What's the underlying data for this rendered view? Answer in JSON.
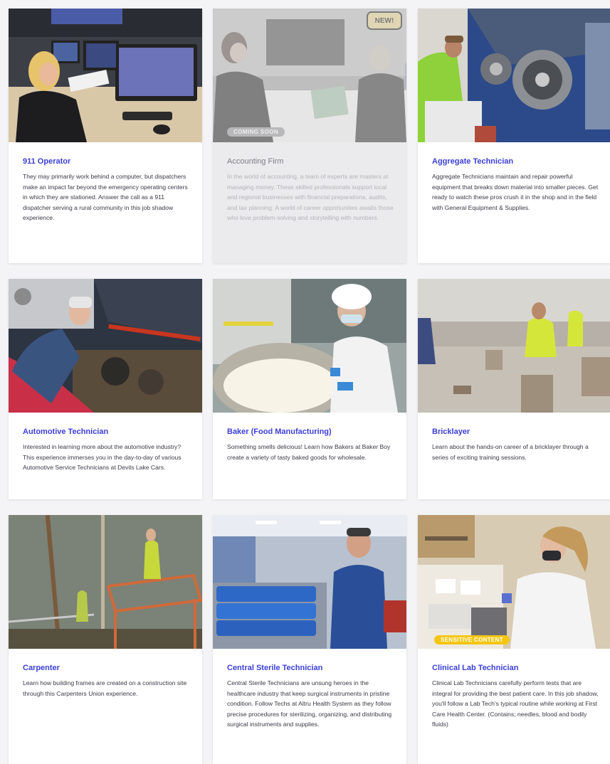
{
  "colors": {
    "title": "#3b3fd6",
    "coming_soon_badge": "#8f8f95",
    "sensitive_badge": "#f4c60f",
    "new_badge": "#f6c628"
  },
  "cards": [
    {
      "title": "911 Operator",
      "description": "They may primarily work behind a computer, but dispatchers make an impact far beyond the emergency operating centers in which they are stationed. Answer the call as a 911 dispatcher serving a rural community in this job shadow experience.",
      "image": "dispatcher-at-monitors-photo"
    },
    {
      "title": "Accounting Firm",
      "description": "In the world of accounting, a team of experts are masters at managing money. These skilled professionals support local and regional businesses with financial preparations, audits, and tax planning. A world of career opportunities awaits those who love problem-solving and storytelling with numbers.",
      "image": "accountants-at-desk-photo",
      "badge": "COMING SOON",
      "new_label": "NEW!",
      "state": "disabled"
    },
    {
      "title": "Aggregate Technician",
      "description": "Aggregate Technicians maintain and repair powerful equipment that breaks down material into smaller pieces. Get ready to watch these pros crush it in the shop and in the field with General Equipment & Supplies.",
      "image": "technician-with-gears-photo"
    },
    {
      "title": "Automotive Technician",
      "description": "Interested in learning more about the automotive industry? This experience immerses you in the day-to-day of various Automotive Service Technicians at Devils Lake Cars.",
      "image": "mechanic-under-hood-photo"
    },
    {
      "title": "Baker (Food Manufacturing)",
      "description": "Something smells delicious! Learn how Bakers at Baker Boy create a variety of tasty baked goods for wholesale.",
      "image": "baker-with-dough-photo"
    },
    {
      "title": "Bricklayer",
      "description": "Learn about the hands-on career of a bricklayer through a series of exciting training sessions.",
      "image": "bricklayers-workshop-photo"
    },
    {
      "title": "Carpenter",
      "description": "Learn how building frames are created on a construction site through this Carpenters Union experience.",
      "image": "carpenters-scaffold-photo"
    },
    {
      "title": "Central Sterile Technician",
      "description": "Central Sterile Technicians are unsung heroes in the healthcare industry that keep surgical instruments in pristine condition. Follow Techs at Altru Health System as they follow precise procedures for sterilizing, organizing, and distributing surgical instruments and supplies.",
      "image": "sterile-tech-with-cart-photo"
    },
    {
      "title": "Clinical Lab Technician",
      "description": "Clinical Lab Technicians carefully perform tests that are integral for providing the best patient care. In this job shadow, you'll follow a Lab Tech's typical routine while working at First Care Health Center. (Contains; needles, blood and bodily fluids)",
      "image": "lab-tech-with-samples-photo",
      "badge": "SENSITIVE CONTENT"
    }
  ]
}
